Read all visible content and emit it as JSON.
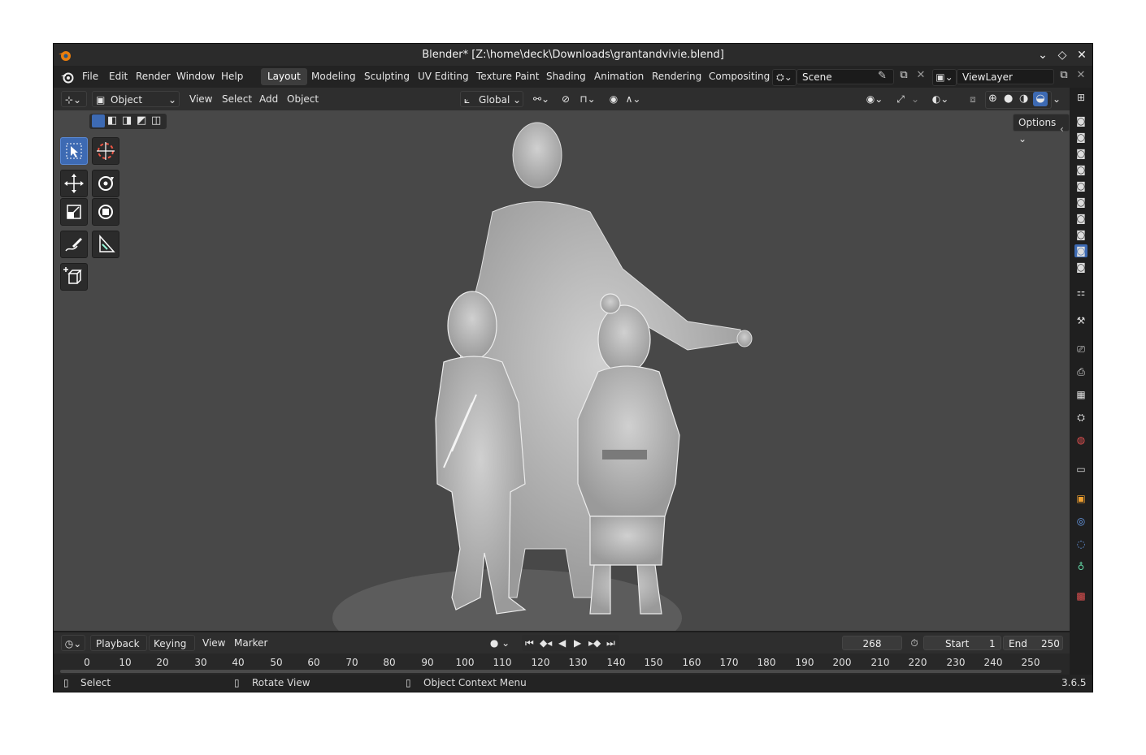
{
  "window": {
    "title": "Blender* [Z:\\home\\deck\\Downloads\\grantandvivie.blend]"
  },
  "menu": [
    "File",
    "Edit",
    "Render",
    "Window",
    "Help"
  ],
  "workspaces": [
    "Layout",
    "Modeling",
    "Sculpting",
    "UV Editing",
    "Texture Paint",
    "Shading",
    "Animation",
    "Rendering",
    "Compositing"
  ],
  "active_workspace": "Layout",
  "scene": {
    "name": "Scene"
  },
  "view_layer": {
    "name": "ViewLayer"
  },
  "header": {
    "mode": "Object Mode",
    "menus": [
      "View",
      "Select",
      "Add",
      "Object"
    ],
    "orientation": "Global",
    "options": "Options"
  },
  "timeline": {
    "menus": [
      "Playback",
      "Keying",
      "View",
      "Marker"
    ],
    "current_frame": "268",
    "start_label": "Start",
    "start": "1",
    "end_label": "End",
    "end": "250",
    "ruler": [
      "0",
      "10",
      "20",
      "30",
      "40",
      "50",
      "60",
      "70",
      "80",
      "90",
      "100",
      "110",
      "120",
      "130",
      "140",
      "150",
      "160",
      "170",
      "180",
      "190",
      "200",
      "210",
      "220",
      "230",
      "240",
      "250"
    ]
  },
  "status": {
    "select": "Select",
    "rotate": "Rotate View",
    "context": "Object Context Menu",
    "version": "3.6.5"
  },
  "colors": {
    "accent": "#3d6ab3",
    "viewport_bg": "#484848",
    "model": "#bdbdbd"
  },
  "icons": [
    "blender-logo-icon",
    "select-box-icon",
    "cursor-icon",
    "move-icon",
    "rotate-icon",
    "scale-icon",
    "transform-icon",
    "annotate-icon",
    "measure-icon",
    "add-cube-icon",
    "camera-icon",
    "render-icon",
    "output-icon",
    "view-layer-icon",
    "scene-icon",
    "world-icon",
    "collection-icon",
    "object-icon",
    "modifier-icon",
    "particles-icon",
    "physics-icon",
    "texture-icon"
  ]
}
